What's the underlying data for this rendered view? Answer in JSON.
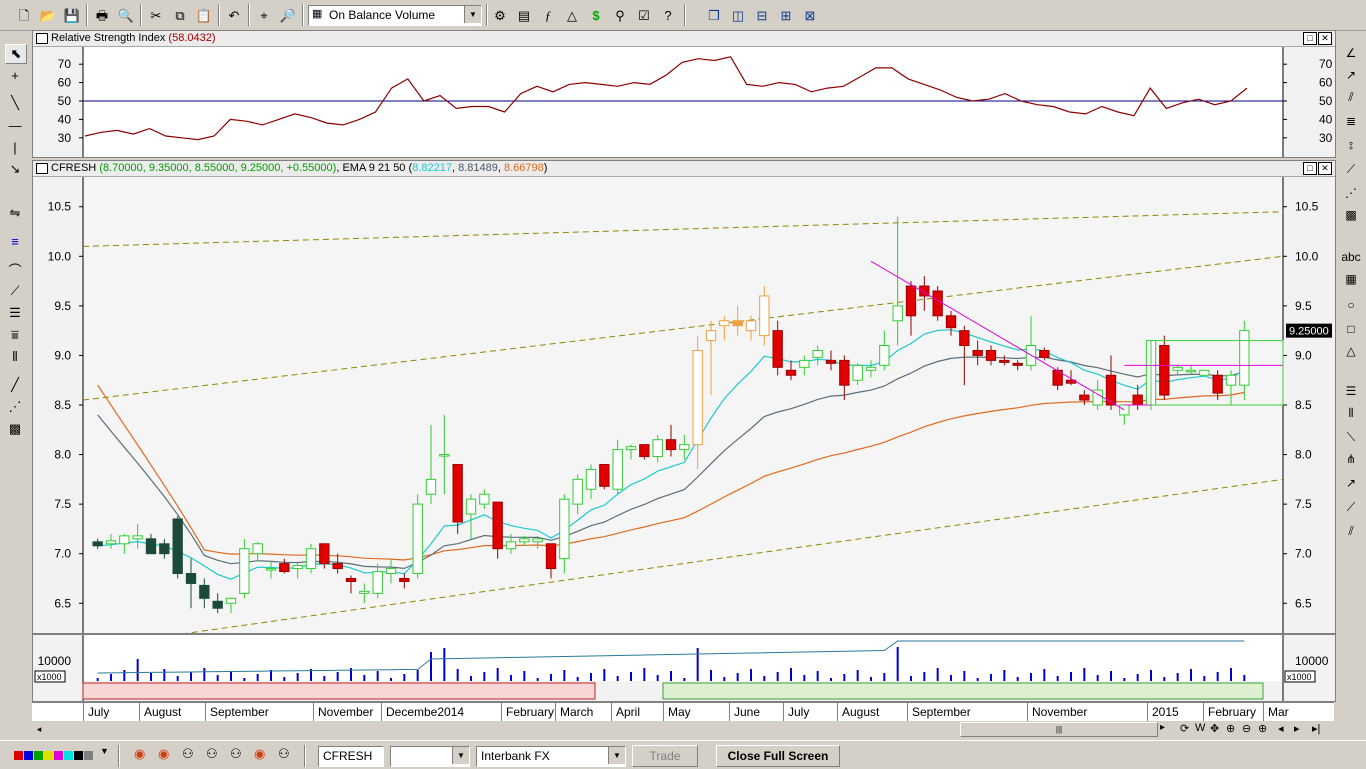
{
  "toolbar": {
    "indicator_select": "On Balance Volume"
  },
  "rsi_panel": {
    "name": "Relative Strength Index",
    "value": "(58.0432)",
    "ticks": [
      "70",
      "60",
      "50",
      "40",
      "30"
    ]
  },
  "price_panel": {
    "symbol": "CFRESH",
    "ohlc": "(8.70000, 9.35000, 8.55000, 9.25000, +0.55000)",
    "ema_label": "EMA 9 21 50",
    "ema_open": "(",
    "ema_fast": "8.82217",
    "ema_mid": "8.81489",
    "ema_slow": "8.66798",
    "ema_close": ")",
    "last_price": "9.25000",
    "ticks": [
      "10.5",
      "10.0",
      "9.5",
      "9.0",
      "8.5",
      "8.0",
      "7.5",
      "7.0",
      "6.5"
    ]
  },
  "volume_panel": {
    "tick": "10000",
    "multiplier": "x1000"
  },
  "x_axis": {
    "months": [
      "July",
      "August",
      "September",
      "November",
      "Decembe2014",
      "February",
      "March",
      "April",
      "May",
      "June",
      "July",
      "August",
      "September",
      "November",
      "2015",
      "February",
      "Mar"
    ]
  },
  "statusbar": {
    "symbol": "CFRESH",
    "timeframe": "",
    "feed": "Interbank FX",
    "trade_label": "Trade",
    "close_label": "Close Full Screen"
  },
  "colors": {
    "rsi_line": "#8b0000",
    "rsi_level": "#00008b",
    "bull_candle": "#32cd32",
    "bear_candle": "#e00000",
    "ema_fast": "#1fc8d0",
    "ema_mid": "#5a6e7a",
    "ema_slow": "#e06a1e",
    "channel": "#8a8a00",
    "trendline": "#e000e0",
    "volume": "#0000cc"
  },
  "chart_data": {
    "type": "candlestick",
    "series_rsi": {
      "ylim": [
        25,
        75
      ],
      "level": 50,
      "values": [
        31,
        33,
        34,
        32,
        35,
        31,
        30,
        29,
        31,
        40,
        39,
        37,
        40,
        43,
        41,
        38,
        37,
        40,
        44,
        57,
        62,
        50,
        53,
        46,
        47,
        47,
        44,
        54,
        58,
        55,
        59,
        60,
        59,
        58,
        60,
        59,
        64,
        71,
        73,
        72,
        74,
        59,
        58,
        60,
        59,
        55,
        57,
        58,
        63,
        68,
        68,
        62,
        59,
        56,
        52,
        50,
        51,
        54,
        50,
        48,
        47,
        44,
        43,
        47,
        44,
        42,
        57,
        46,
        49,
        51,
        48,
        50,
        57
      ]
    },
    "candles_ylim": [
      6.2,
      10.8
    ],
    "candles": [
      [
        7.12,
        7.15,
        7.05,
        7.08
      ],
      [
        7.1,
        7.2,
        7.05,
        7.13
      ],
      [
        7.1,
        7.2,
        7.0,
        7.18
      ],
      [
        7.15,
        7.3,
        7.05,
        7.18
      ],
      [
        7.15,
        7.2,
        7.0,
        7.0
      ],
      [
        7.1,
        7.15,
        6.95,
        7.0
      ],
      [
        7.35,
        7.38,
        6.75,
        6.8
      ],
      [
        6.8,
        6.95,
        6.45,
        6.7
      ],
      [
        6.68,
        6.75,
        6.45,
        6.55
      ],
      [
        6.52,
        6.6,
        6.4,
        6.45
      ],
      [
        6.5,
        6.55,
        6.4,
        6.55
      ],
      [
        6.6,
        7.15,
        6.55,
        7.05
      ],
      [
        7.0,
        7.12,
        6.92,
        7.1
      ],
      [
        6.85,
        6.92,
        6.75,
        6.85
      ],
      [
        6.9,
        6.95,
        6.8,
        6.82
      ],
      [
        6.85,
        6.92,
        6.75,
        6.88
      ],
      [
        6.85,
        7.1,
        6.8,
        7.05
      ],
      [
        7.1,
        7.1,
        6.85,
        6.9
      ],
      [
        6.9,
        7.0,
        6.8,
        6.85
      ],
      [
        6.75,
        6.78,
        6.6,
        6.72
      ],
      [
        6.6,
        6.7,
        6.5,
        6.62
      ],
      [
        6.6,
        6.9,
        6.55,
        6.82
      ],
      [
        6.8,
        6.95,
        6.7,
        6.85
      ],
      [
        6.75,
        6.8,
        6.65,
        6.72
      ],
      [
        6.8,
        7.6,
        6.75,
        7.5
      ],
      [
        7.6,
        8.3,
        7.5,
        7.75
      ],
      [
        8.0,
        8.4,
        7.6,
        8.0
      ],
      [
        7.9,
        7.9,
        7.2,
        7.32
      ],
      [
        7.4,
        7.6,
        7.15,
        7.55
      ],
      [
        7.5,
        7.65,
        7.45,
        7.6
      ],
      [
        7.52,
        7.52,
        6.95,
        7.05
      ],
      [
        7.05,
        7.2,
        7.0,
        7.12
      ],
      [
        7.12,
        7.18,
        7.08,
        7.15
      ],
      [
        7.12,
        7.18,
        7.05,
        7.15
      ],
      [
        7.1,
        7.1,
        6.75,
        6.85
      ],
      [
        6.95,
        7.6,
        6.8,
        7.55
      ],
      [
        7.5,
        7.8,
        7.4,
        7.75
      ],
      [
        7.65,
        7.9,
        7.55,
        7.85
      ],
      [
        7.9,
        7.9,
        7.65,
        7.68
      ],
      [
        7.65,
        8.15,
        7.6,
        8.05
      ],
      [
        8.05,
        8.1,
        7.95,
        8.08
      ],
      [
        8.1,
        8.1,
        7.95,
        7.98
      ],
      [
        7.98,
        8.2,
        7.92,
        8.15
      ],
      [
        8.15,
        8.3,
        7.98,
        8.05
      ],
      [
        8.05,
        8.2,
        7.95,
        8.1
      ],
      [
        8.1,
        9.2,
        7.85,
        9.05
      ],
      [
        9.15,
        9.35,
        8.6,
        9.25
      ],
      [
        9.3,
        9.4,
        9.15,
        9.35
      ],
      [
        9.35,
        9.5,
        9.2,
        9.3
      ],
      [
        9.25,
        9.4,
        9.15,
        9.35
      ],
      [
        9.2,
        9.7,
        9.1,
        9.6
      ],
      [
        9.25,
        9.35,
        8.8,
        8.88
      ],
      [
        8.85,
        8.95,
        8.75,
        8.8
      ],
      [
        8.88,
        9.0,
        8.8,
        8.95
      ],
      [
        8.98,
        9.1,
        8.9,
        9.05
      ],
      [
        8.95,
        9.05,
        8.85,
        8.92
      ],
      [
        8.95,
        9.0,
        8.55,
        8.7
      ],
      [
        8.75,
        8.92,
        8.7,
        8.9
      ],
      [
        8.85,
        8.95,
        8.78,
        8.88
      ],
      [
        8.9,
        9.25,
        8.85,
        9.1
      ],
      [
        9.35,
        10.4,
        9.1,
        9.5
      ],
      [
        9.7,
        9.75,
        9.2,
        9.4
      ],
      [
        9.7,
        9.8,
        9.45,
        9.6
      ],
      [
        9.65,
        9.7,
        9.35,
        9.4
      ],
      [
        9.4,
        9.45,
        9.2,
        9.28
      ],
      [
        9.25,
        9.3,
        8.7,
        9.1
      ],
      [
        9.05,
        9.15,
        8.9,
        9.0
      ],
      [
        9.05,
        9.1,
        8.9,
        8.95
      ],
      [
        8.95,
        9.0,
        8.9,
        8.93
      ],
      [
        8.92,
        8.95,
        8.85,
        8.9
      ],
      [
        8.9,
        9.4,
        8.85,
        9.1
      ],
      [
        9.05,
        9.08,
        8.95,
        8.98
      ],
      [
        8.85,
        8.88,
        8.65,
        8.7
      ],
      [
        8.75,
        8.85,
        8.7,
        8.72
      ],
      [
        8.6,
        8.65,
        8.5,
        8.55
      ],
      [
        8.5,
        8.75,
        8.45,
        8.65
      ],
      [
        8.8,
        9.0,
        8.45,
        8.5
      ],
      [
        8.4,
        8.5,
        8.3,
        8.5
      ],
      [
        8.6,
        8.7,
        8.45,
        8.5
      ],
      [
        8.5,
        9.1,
        8.45,
        9.15
      ],
      [
        9.1,
        9.2,
        8.55,
        8.6
      ],
      [
        8.85,
        8.9,
        8.8,
        8.88
      ],
      [
        8.85,
        8.9,
        8.8,
        8.85
      ],
      [
        8.8,
        8.85,
        8.8,
        8.85
      ],
      [
        8.8,
        8.85,
        8.55,
        8.62
      ],
      [
        8.7,
        8.85,
        8.5,
        8.8
      ],
      [
        8.7,
        9.35,
        8.55,
        9.25
      ]
    ]
  }
}
